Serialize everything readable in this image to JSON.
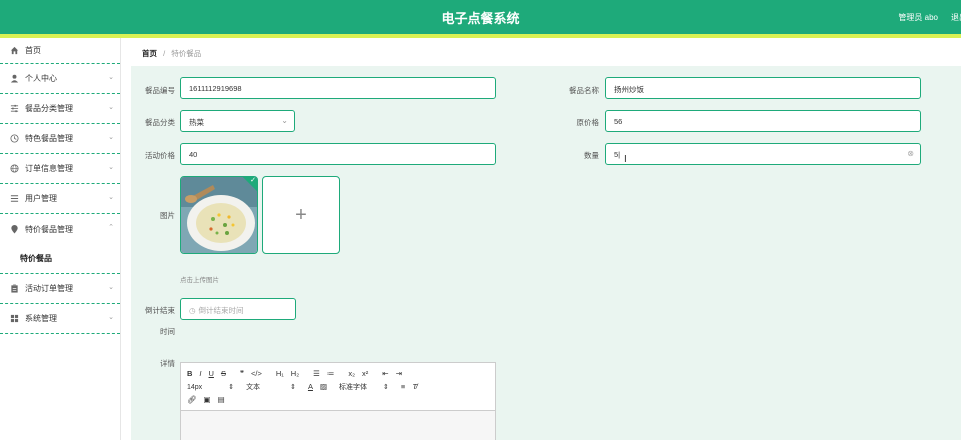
{
  "header": {
    "title": "电子点餐系统",
    "admin": "管理员 abo",
    "logout": "退出"
  },
  "sidebar": {
    "items": [
      {
        "label": "首页",
        "icon": "home-icon"
      },
      {
        "label": "个人中心",
        "icon": "user-icon"
      },
      {
        "label": "餐品分类管理",
        "icon": "sliders-icon"
      },
      {
        "label": "特色餐品管理",
        "icon": "clock-icon"
      },
      {
        "label": "订单信息管理",
        "icon": "globe-icon"
      },
      {
        "label": "用户管理",
        "icon": "list-icon"
      },
      {
        "label": "特价餐品管理",
        "icon": "location-icon"
      },
      {
        "label": "活动订单管理",
        "icon": "clipboard-icon"
      },
      {
        "label": "系统管理",
        "icon": "grid-icon"
      }
    ],
    "submenu": {
      "label": "特价餐品"
    }
  },
  "breadcrumb": {
    "home": "首页",
    "separator": "/",
    "current": "特价餐品"
  },
  "form": {
    "code_label": "餐品编号",
    "code_value": "1611112919698",
    "name_label": "餐品名称",
    "name_value": "扬州炒饭",
    "category_label": "餐品分类",
    "category_value": "热菜",
    "original_price_label": "原价格",
    "original_price_value": "56",
    "activity_price_label": "活动价格",
    "activity_price_value": "40",
    "quantity_label": "数量",
    "quantity_value": "5",
    "image_label": "图片",
    "upload_hint": "点击上传图片",
    "countdown_label_1": "倒计结束",
    "countdown_label_2": "时间",
    "countdown_placeholder": "倒计结束时间",
    "details_label": "详情"
  },
  "editor": {
    "toolbar_row1": [
      "B",
      "I",
      "U",
      "S",
      "❞",
      "</>",
      "H₁",
      "H₂",
      "☰",
      "≔",
      "x₂",
      "x²",
      "⇤",
      "⇥"
    ],
    "font_size": "14px",
    "text_style": "文本",
    "font_family": "标准字体"
  },
  "colors": {
    "primary": "#1eaa7a",
    "accent": "#d9f154",
    "content_bg": "#eaf5f0"
  }
}
